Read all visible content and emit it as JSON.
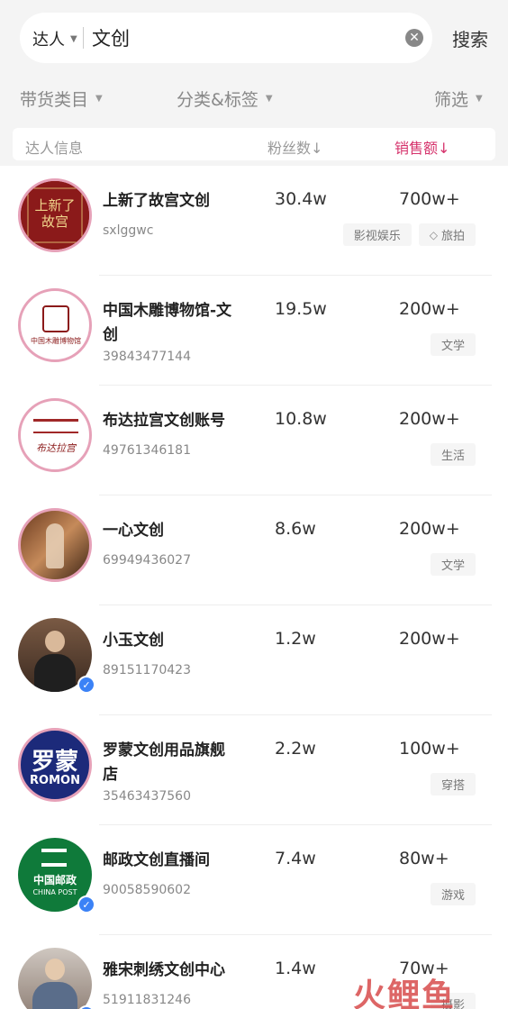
{
  "search": {
    "scope_label": "达人",
    "query": "文创",
    "submit_label": "搜索"
  },
  "filters": {
    "category": "带货类目",
    "tags": "分类&标签",
    "screen": "筛选"
  },
  "columns": {
    "info": "达人信息",
    "fans": "粉丝数",
    "sales": "销售额",
    "sort_glyph": "↓"
  },
  "rows": [
    {
      "name": "上新了故宫文创",
      "uid": "sxlggwc",
      "fans": "30.4w",
      "sales": "700w+",
      "tags": [
        "影视娱乐",
        "旅拍"
      ],
      "avatar_icon": "gugong-logo-icon",
      "avatar_text": "上新了故宫",
      "verified": false
    },
    {
      "name": "中国木雕博物馆-文创",
      "uid": "39843477144",
      "fans": "19.5w",
      "sales": "200w+",
      "tags": [
        "文学"
      ],
      "avatar_icon": "museum-logo-icon",
      "avatar_text": "中国木雕博物馆",
      "verified": false
    },
    {
      "name": "布达拉宫文创账号",
      "uid": "49761346181",
      "fans": "10.8w",
      "sales": "200w+",
      "tags": [
        "生活"
      ],
      "avatar_icon": "potala-logo-icon",
      "avatar_text": "布达拉宫",
      "verified": false
    },
    {
      "name": "一心文创",
      "uid": "69949436027",
      "fans": "8.6w",
      "sales": "200w+",
      "tags": [
        "文学"
      ],
      "avatar_icon": "photo-avatar-icon",
      "avatar_text": "",
      "verified": false
    },
    {
      "name": "小玉文创",
      "uid": "89151170423",
      "fans": "1.2w",
      "sales": "200w+",
      "tags": [],
      "avatar_icon": "person-avatar-icon",
      "avatar_text": "",
      "verified": true
    },
    {
      "name": "罗蒙文创用品旗舰店",
      "uid": "35463437560",
      "fans": "2.2w",
      "sales": "100w+",
      "tags": [
        "穿搭"
      ],
      "avatar_icon": "romon-logo-icon",
      "avatar_text": "罗蒙",
      "avatar_subtext": "ROMON",
      "verified": false
    },
    {
      "name": "邮政文创直播间",
      "uid": "90058590602",
      "fans": "7.4w",
      "sales": "80w+",
      "tags": [
        "游戏"
      ],
      "avatar_icon": "china-post-logo-icon",
      "avatar_text": "中国邮政",
      "avatar_subtext": "CHINA POST",
      "verified": true
    },
    {
      "name": "雅宋刺绣文创中心",
      "uid": "51911831246",
      "fans": "1.4w",
      "sales": "70w+",
      "tags": [
        "摄影"
      ],
      "avatar_icon": "person-avatar-icon",
      "avatar_text": "",
      "verified": true
    }
  ],
  "watermark": "火鲤鱼",
  "colors": {
    "accent": "#d6336c",
    "verified": "#3b82f6",
    "gugong_red": "#8b1a1a",
    "romon_blue": "#1c2a7a",
    "post_green": "#0f7a3a"
  }
}
